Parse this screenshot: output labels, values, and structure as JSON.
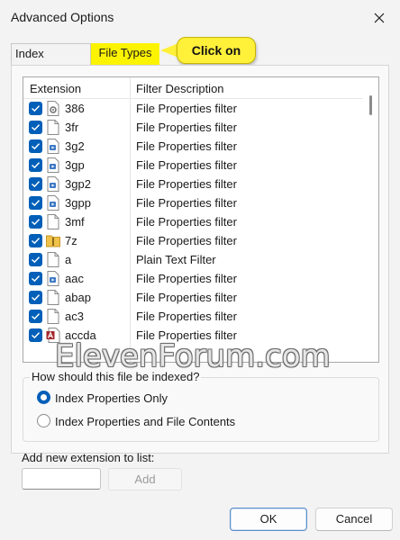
{
  "window": {
    "title": "Advanced Options"
  },
  "tabs": [
    {
      "label": "Index Settings",
      "selected": false
    },
    {
      "label": "File Types",
      "selected": true,
      "highlight_color": "#fcf300"
    }
  ],
  "callout": {
    "text": "Click on",
    "color": "#fff03a"
  },
  "list": {
    "columns": [
      "Extension",
      "Filter Description"
    ],
    "rows": [
      {
        "checked": true,
        "ext": "386",
        "desc": "File Properties filter",
        "icon": "settings-file-icon"
      },
      {
        "checked": true,
        "ext": "3fr",
        "desc": "File Properties filter",
        "icon": "blank-file-icon"
      },
      {
        "checked": true,
        "ext": "3g2",
        "desc": "File Properties filter",
        "icon": "media-file-icon"
      },
      {
        "checked": true,
        "ext": "3gp",
        "desc": "File Properties filter",
        "icon": "media-file-icon"
      },
      {
        "checked": true,
        "ext": "3gp2",
        "desc": "File Properties filter",
        "icon": "media-file-icon"
      },
      {
        "checked": true,
        "ext": "3gpp",
        "desc": "File Properties filter",
        "icon": "media-file-icon"
      },
      {
        "checked": true,
        "ext": "3mf",
        "desc": "File Properties filter",
        "icon": "blank-file-icon"
      },
      {
        "checked": true,
        "ext": "7z",
        "desc": "File Properties filter",
        "icon": "zip-folder-icon"
      },
      {
        "checked": true,
        "ext": "a",
        "desc": "Plain Text Filter",
        "icon": "blank-file-icon"
      },
      {
        "checked": true,
        "ext": "aac",
        "desc": "File Properties filter",
        "icon": "media-file-icon"
      },
      {
        "checked": true,
        "ext": "abap",
        "desc": "File Properties filter",
        "icon": "blank-file-icon"
      },
      {
        "checked": true,
        "ext": "ac3",
        "desc": "File Properties filter",
        "icon": "blank-file-icon"
      },
      {
        "checked": true,
        "ext": "accda",
        "desc": "File Properties filter",
        "icon": "access-file-icon"
      }
    ]
  },
  "watermark": "ElevenForum.com",
  "index_group": {
    "label": "How should this file be indexed?",
    "options": [
      {
        "label": "Index Properties Only",
        "selected": true
      },
      {
        "label": "Index Properties and File Contents",
        "selected": false
      }
    ]
  },
  "add_extension": {
    "label": "Add new extension to list:",
    "value": "",
    "button": "Add"
  },
  "footer": {
    "ok": "OK",
    "cancel": "Cancel"
  },
  "colors": {
    "accent": "#005fb8",
    "background": "#f3f3f3"
  }
}
